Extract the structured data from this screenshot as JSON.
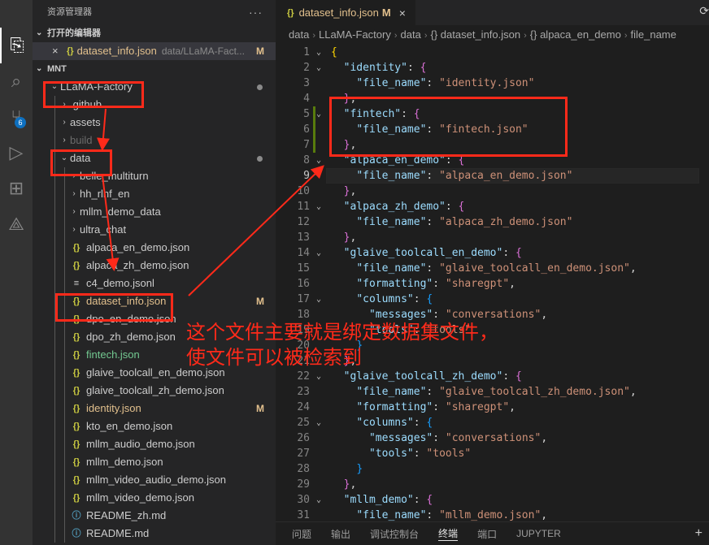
{
  "activity_bar": {
    "items": [
      {
        "icon": "files-icon",
        "glyph": "⎘",
        "active": true
      },
      {
        "icon": "search-icon",
        "glyph": "⌕",
        "active": false
      },
      {
        "icon": "source-control-icon",
        "glyph": "⑂",
        "active": false,
        "badge": "6"
      },
      {
        "icon": "run-debug-icon",
        "glyph": "▷",
        "active": false
      },
      {
        "icon": "extensions-icon",
        "glyph": "⊞",
        "active": false
      },
      {
        "icon": "remote-icon",
        "glyph": "⟁",
        "active": false
      }
    ]
  },
  "sidebar": {
    "title": "资源管理器",
    "more": "···",
    "open_editors": {
      "header": "打开的编辑器",
      "item": {
        "close": "×",
        "icon": "{}",
        "name": "dataset_info.json",
        "path": "data/LLaMA-Fact...",
        "mark": "M"
      }
    },
    "workspace": {
      "header": "MNT",
      "rows": [
        {
          "label": "LLaMA-Factory",
          "type": "folder-open",
          "depth": 0,
          "dot": true
        },
        {
          "label": ".github",
          "type": "folder",
          "depth": 1
        },
        {
          "label": "assets",
          "type": "folder",
          "depth": 1
        },
        {
          "label": "build",
          "type": "folder",
          "depth": 1,
          "faded": true
        },
        {
          "label": "data",
          "type": "folder-open",
          "depth": 1,
          "dot": true
        },
        {
          "label": "belle_multiturn",
          "type": "folder",
          "depth": 2
        },
        {
          "label": "hh_rlhf_en",
          "type": "folder",
          "depth": 2
        },
        {
          "label": "mllm_demo_data",
          "type": "folder",
          "depth": 2
        },
        {
          "label": "ultra_chat",
          "type": "folder",
          "depth": 2
        },
        {
          "label": "alpaca_en_demo.json",
          "type": "json",
          "depth": 2
        },
        {
          "label": "alpaca_zh_demo.json",
          "type": "json",
          "depth": 2
        },
        {
          "label": "c4_demo.jsonl",
          "type": "lines",
          "depth": 2
        },
        {
          "label": "dataset_info.json",
          "type": "json",
          "depth": 2,
          "status": "modified",
          "mark": "M"
        },
        {
          "label": "dpo_en_demo.json",
          "type": "json",
          "depth": 2
        },
        {
          "label": "dpo_zh_demo.json",
          "type": "json",
          "depth": 2
        },
        {
          "label": "fintech.json",
          "type": "json",
          "depth": 2,
          "status": "untracked"
        },
        {
          "label": "glaive_toolcall_en_demo.json",
          "type": "json",
          "depth": 2
        },
        {
          "label": "glaive_toolcall_zh_demo.json",
          "type": "json",
          "depth": 2
        },
        {
          "label": "identity.json",
          "type": "json",
          "depth": 2,
          "status": "modified",
          "mark": "M"
        },
        {
          "label": "kto_en_demo.json",
          "type": "json",
          "depth": 2
        },
        {
          "label": "mllm_audio_demo.json",
          "type": "json",
          "depth": 2
        },
        {
          "label": "mllm_demo.json",
          "type": "json",
          "depth": 2
        },
        {
          "label": "mllm_video_audio_demo.json",
          "type": "json",
          "depth": 2
        },
        {
          "label": "mllm_video_demo.json",
          "type": "json",
          "depth": 2
        },
        {
          "label": "README_zh.md",
          "type": "md",
          "depth": 2
        },
        {
          "label": "README.md",
          "type": "md",
          "depth": 2
        }
      ]
    }
  },
  "editor": {
    "tab": {
      "icon": "{}",
      "name": "dataset_info.json",
      "mark": "M",
      "close": "×"
    },
    "tab_actions": "⟳",
    "breadcrumb": [
      "data",
      "LLaMA-Factory",
      "data",
      "{} dataset_info.json",
      "{} alpaca_en_demo",
      "file_name"
    ],
    "current_line": 9,
    "lines": [
      [
        [
          "b1",
          "{"
        ]
      ],
      [
        [
          "p",
          "  "
        ],
        [
          "k",
          "\"identity\""
        ],
        [
          "p",
          ": "
        ],
        [
          "b2",
          "{"
        ]
      ],
      [
        [
          "p",
          "    "
        ],
        [
          "k",
          "\"file_name\""
        ],
        [
          "p",
          ": "
        ],
        [
          "s",
          "\"identity.json\""
        ]
      ],
      [
        [
          "p",
          "  "
        ],
        [
          "b2",
          "}"
        ],
        [
          "p",
          ","
        ]
      ],
      [
        [
          "p",
          "  "
        ],
        [
          "k",
          "\"fintech\""
        ],
        [
          "p",
          ": "
        ],
        [
          "b2",
          "{"
        ]
      ],
      [
        [
          "p",
          "    "
        ],
        [
          "k",
          "\"file_name\""
        ],
        [
          "p",
          ": "
        ],
        [
          "s",
          "\"fintech.json\""
        ]
      ],
      [
        [
          "p",
          "  "
        ],
        [
          "b2",
          "}"
        ],
        [
          "p",
          ","
        ]
      ],
      [
        [
          "p",
          "  "
        ],
        [
          "k",
          "\"alpaca_en_demo\""
        ],
        [
          "p",
          ": "
        ],
        [
          "b2",
          "{"
        ]
      ],
      [
        [
          "p",
          "    "
        ],
        [
          "k",
          "\"file_name\""
        ],
        [
          "p",
          ": "
        ],
        [
          "s",
          "\"alpaca_en_demo.json\""
        ]
      ],
      [
        [
          "p",
          "  "
        ],
        [
          "b2",
          "}"
        ],
        [
          "p",
          ","
        ]
      ],
      [
        [
          "p",
          "  "
        ],
        [
          "k",
          "\"alpaca_zh_demo\""
        ],
        [
          "p",
          ": "
        ],
        [
          "b2",
          "{"
        ]
      ],
      [
        [
          "p",
          "    "
        ],
        [
          "k",
          "\"file_name\""
        ],
        [
          "p",
          ": "
        ],
        [
          "s",
          "\"alpaca_zh_demo.json\""
        ]
      ],
      [
        [
          "p",
          "  "
        ],
        [
          "b2",
          "}"
        ],
        [
          "p",
          ","
        ]
      ],
      [
        [
          "p",
          "  "
        ],
        [
          "k",
          "\"glaive_toolcall_en_demo\""
        ],
        [
          "p",
          ": "
        ],
        [
          "b2",
          "{"
        ]
      ],
      [
        [
          "p",
          "    "
        ],
        [
          "k",
          "\"file_name\""
        ],
        [
          "p",
          ": "
        ],
        [
          "s",
          "\"glaive_toolcall_en_demo.json\""
        ],
        [
          "p",
          ","
        ]
      ],
      [
        [
          "p",
          "    "
        ],
        [
          "k",
          "\"formatting\""
        ],
        [
          "p",
          ": "
        ],
        [
          "s",
          "\"sharegpt\""
        ],
        [
          "p",
          ","
        ]
      ],
      [
        [
          "p",
          "    "
        ],
        [
          "k",
          "\"columns\""
        ],
        [
          "p",
          ": "
        ],
        [
          "b3",
          "{"
        ]
      ],
      [
        [
          "p",
          "      "
        ],
        [
          "k",
          "\"messages\""
        ],
        [
          "p",
          ": "
        ],
        [
          "s",
          "\"conversations\""
        ],
        [
          "p",
          ","
        ]
      ],
      [
        [
          "p",
          "      "
        ],
        [
          "k",
          "\"tools\""
        ],
        [
          "p",
          ": "
        ],
        [
          "s",
          "\"tools\""
        ]
      ],
      [
        [
          "p",
          "    "
        ],
        [
          "b3",
          "}"
        ]
      ],
      [
        [
          "p",
          "  "
        ],
        [
          "b2",
          "}"
        ],
        [
          "p",
          ","
        ]
      ],
      [
        [
          "p",
          "  "
        ],
        [
          "k",
          "\"glaive_toolcall_zh_demo\""
        ],
        [
          "p",
          ": "
        ],
        [
          "b2",
          "{"
        ]
      ],
      [
        [
          "p",
          "    "
        ],
        [
          "k",
          "\"file_name\""
        ],
        [
          "p",
          ": "
        ],
        [
          "s",
          "\"glaive_toolcall_zh_demo.json\""
        ],
        [
          "p",
          ","
        ]
      ],
      [
        [
          "p",
          "    "
        ],
        [
          "k",
          "\"formatting\""
        ],
        [
          "p",
          ": "
        ],
        [
          "s",
          "\"sharegpt\""
        ],
        [
          "p",
          ","
        ]
      ],
      [
        [
          "p",
          "    "
        ],
        [
          "k",
          "\"columns\""
        ],
        [
          "p",
          ": "
        ],
        [
          "b3",
          "{"
        ]
      ],
      [
        [
          "p",
          "      "
        ],
        [
          "k",
          "\"messages\""
        ],
        [
          "p",
          ": "
        ],
        [
          "s",
          "\"conversations\""
        ],
        [
          "p",
          ","
        ]
      ],
      [
        [
          "p",
          "      "
        ],
        [
          "k",
          "\"tools\""
        ],
        [
          "p",
          ": "
        ],
        [
          "s",
          "\"tools\""
        ]
      ],
      [
        [
          "p",
          "    "
        ],
        [
          "b3",
          "}"
        ]
      ],
      [
        [
          "p",
          "  "
        ],
        [
          "b2",
          "}"
        ],
        [
          "p",
          ","
        ]
      ],
      [
        [
          "p",
          "  "
        ],
        [
          "k",
          "\"mllm_demo\""
        ],
        [
          "p",
          ": "
        ],
        [
          "b2",
          "{"
        ]
      ],
      [
        [
          "p",
          "    "
        ],
        [
          "k",
          "\"file_name\""
        ],
        [
          "p",
          ": "
        ],
        [
          "s",
          "\"mllm_demo.json\""
        ],
        [
          "p",
          ","
        ]
      ]
    ],
    "fold_lines": [
      1,
      2,
      5,
      8,
      11,
      14,
      17,
      22,
      25,
      30
    ]
  },
  "panel": {
    "tabs": [
      "问题",
      "输出",
      "调试控制台",
      "终端",
      "端口",
      "JUPYTER"
    ],
    "active": "终端",
    "plus": "+"
  },
  "annotation": {
    "note_line1": "这个文件主要就是绑定数据集文件，",
    "note_line2": "使文件可以被检索到",
    "color": "#ff2a1a"
  }
}
